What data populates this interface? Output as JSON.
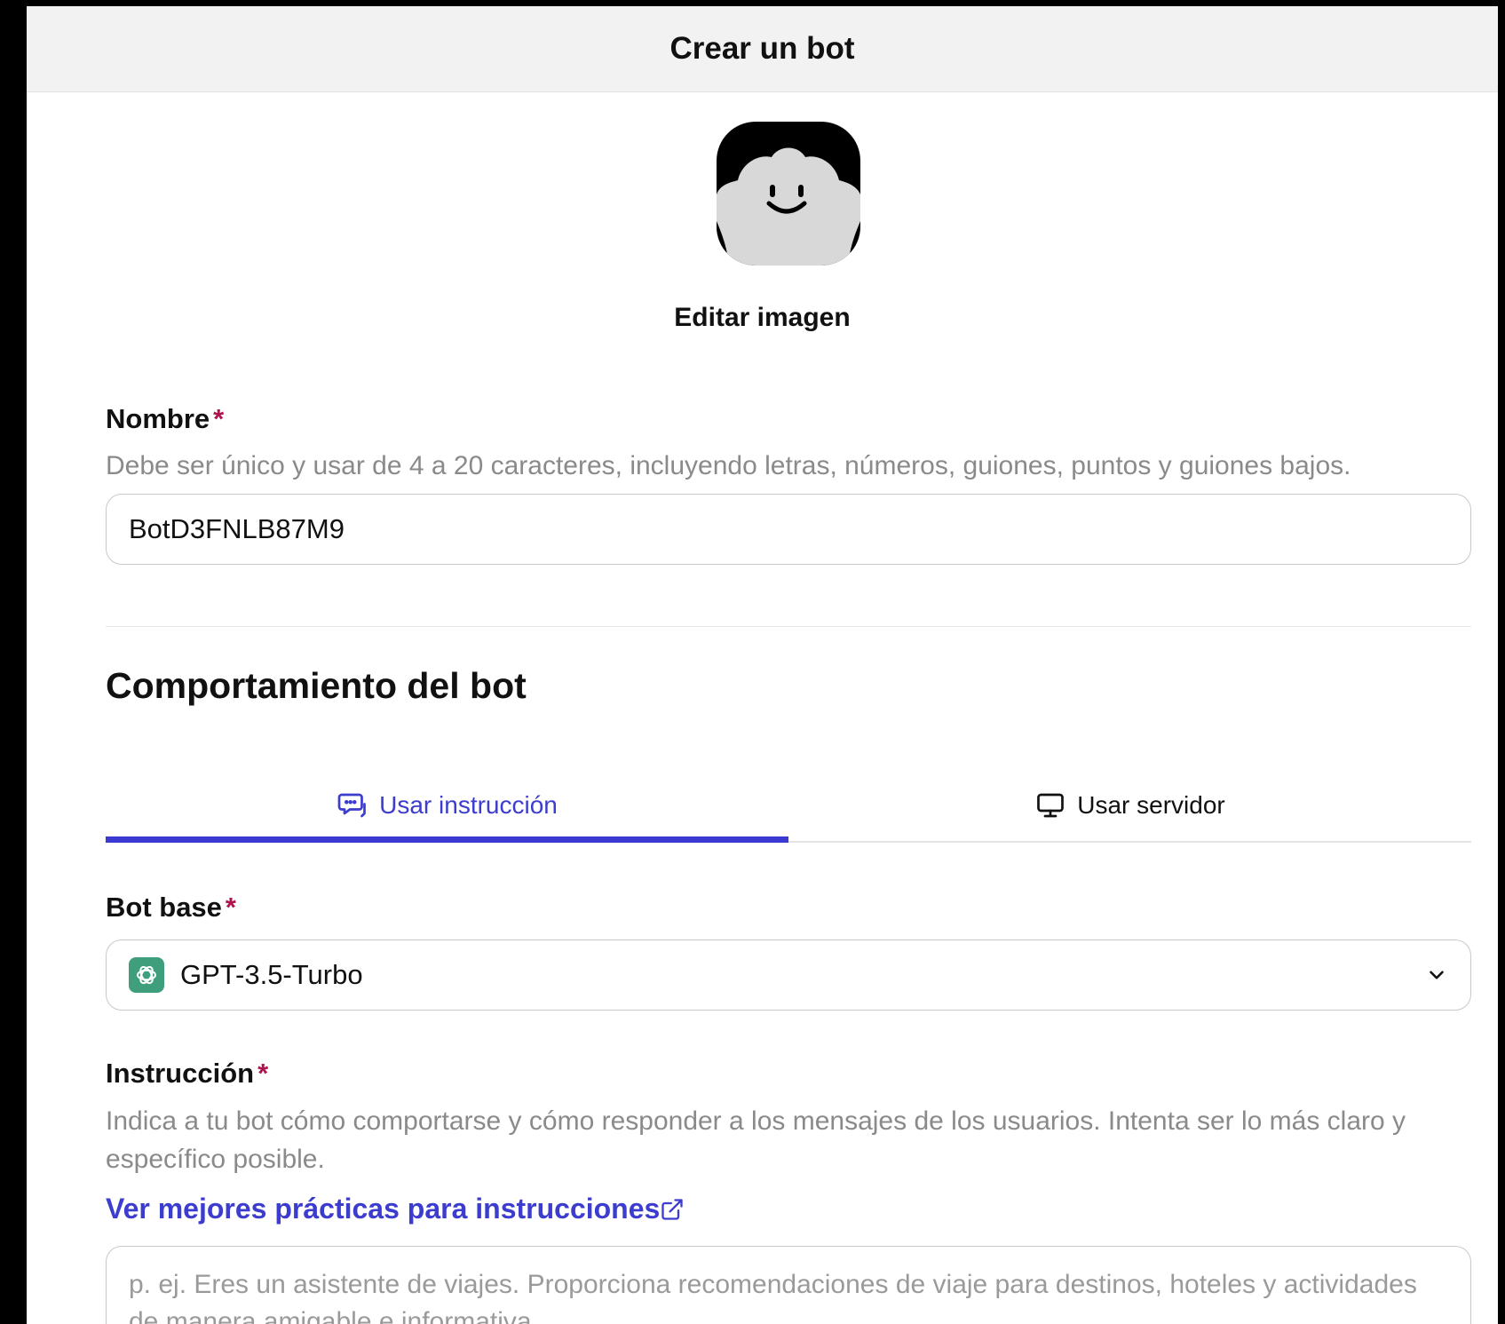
{
  "header": {
    "title": "Crear un bot"
  },
  "avatar": {
    "edit_label": "Editar imagen"
  },
  "name": {
    "label": "Nombre",
    "required_mark": "*",
    "help": "Debe ser único y usar de 4 a 20 caracteres, incluyendo letras, números, guiones, puntos y guiones bajos.",
    "value": "BotD3FNLB87M9"
  },
  "behavior": {
    "title": "Comportamiento del bot",
    "tabs": [
      {
        "label": "Usar instrucción",
        "icon": "chat-bubble-icon",
        "active": true
      },
      {
        "label": "Usar servidor",
        "icon": "monitor-icon",
        "active": false
      }
    ]
  },
  "base_bot": {
    "label": "Bot base",
    "required_mark": "*",
    "selected": "GPT-3.5-Turbo",
    "icon": "openai-icon"
  },
  "instruction": {
    "label": "Instrucción",
    "required_mark": "*",
    "help": "Indica a tu bot cómo comportarse y cómo responder a los mensajes de los usuarios. Intenta ser lo más claro y específico posible.",
    "link": "Ver mejores prácticas para instrucciones",
    "placeholder": "p. ej. Eres un asistente de viajes. Proporciona recomendaciones de viaje para destinos, hoteles y actividades de manera amigable e informativa."
  },
  "colors": {
    "accent": "#3a3ad1",
    "required": "#b0124e",
    "help_text": "#8a8a8a",
    "gpt_green": "#3f9f7c"
  }
}
